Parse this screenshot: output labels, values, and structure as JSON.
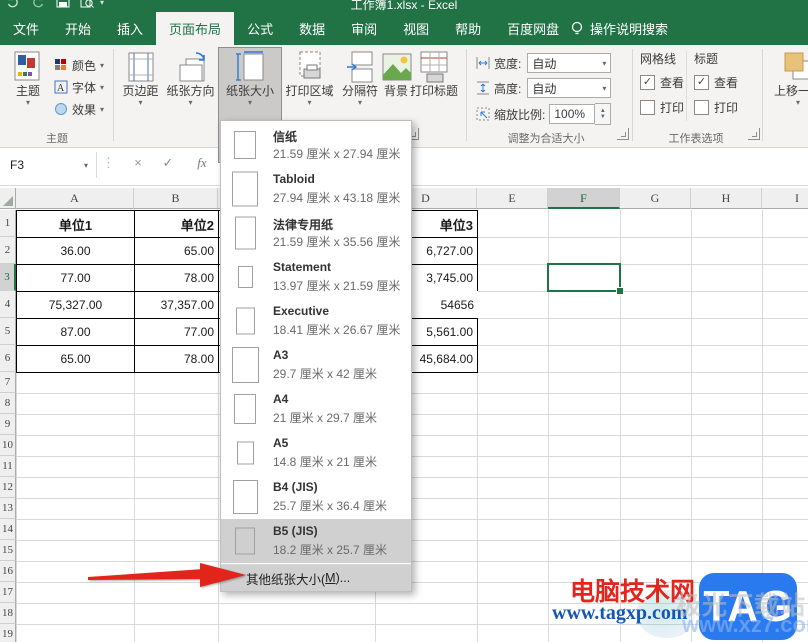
{
  "title_bar": {
    "title": "工作簿1.xlsx - Excel"
  },
  "menu": {
    "tabs": [
      "文件",
      "开始",
      "插入",
      "页面布局",
      "公式",
      "数据",
      "审阅",
      "视图",
      "帮助",
      "百度网盘"
    ],
    "tab_ids": [
      "file",
      "home",
      "insert",
      "page-layout",
      "formulas",
      "data",
      "review",
      "view",
      "help",
      "baidu-netdisk"
    ],
    "active_index": 3,
    "search": "操作说明搜索"
  },
  "ribbon": {
    "themes": {
      "group_label": "主题",
      "theme_button": "主题",
      "colors": "颜色",
      "fonts": "字体",
      "effects": "效果"
    },
    "page_setup": {
      "buttons": [
        "页边距",
        "纸张方向",
        "纸张大小",
        "打印区域",
        "分隔符",
        "背景",
        "打印标题"
      ]
    },
    "scale": {
      "group_label": "调整为合适大小",
      "width_label": "宽度:",
      "width_value": "自动",
      "height_label": "高度:",
      "height_value": "自动",
      "scale_label": "缩放比例:",
      "scale_value": "100%"
    },
    "sheet_options": {
      "group_label": "工作表选项",
      "gridlines_title": "网格线",
      "headings_title": "标题",
      "view_label": "查看",
      "print_label": "打印"
    },
    "arrange": {
      "bring_forward": "上移一层"
    }
  },
  "formula_bar": {
    "name_box": "F3",
    "fx": "fx"
  },
  "paper_size_menu": {
    "items": [
      {
        "name": "信纸",
        "dims": "21.59 厘米 x 27.94 厘米",
        "iw": 20,
        "ih": 26,
        "selected": false
      },
      {
        "name": "Tabloid",
        "dims": "27.94 厘米 x 43.18 厘米",
        "iw": 24,
        "ih": 33,
        "selected": false
      },
      {
        "name": "法律专用纸",
        "dims": "21.59 厘米 x 35.56 厘米",
        "iw": 19,
        "ih": 31,
        "selected": false
      },
      {
        "name": "Statement",
        "dims": "13.97 厘米 x 21.59 厘米",
        "iw": 13,
        "ih": 20,
        "selected": false
      },
      {
        "name": "Executive",
        "dims": "18.41 厘米 x 26.67 厘米",
        "iw": 17,
        "ih": 25,
        "selected": false
      },
      {
        "name": "A3",
        "dims": "29.7 厘米 x 42 厘米",
        "iw": 25,
        "ih": 34,
        "selected": false
      },
      {
        "name": "A4",
        "dims": "21 厘米 x 29.7 厘米",
        "iw": 20,
        "ih": 28,
        "selected": false
      },
      {
        "name": "A5",
        "dims": "14.8 厘米 x 21 厘米",
        "iw": 15,
        "ih": 21,
        "selected": false
      },
      {
        "name": "B4 (JIS)",
        "dims": "25.7 厘米 x 36.4 厘米",
        "iw": 23,
        "ih": 32,
        "selected": false
      },
      {
        "name": "B5 (JIS)",
        "dims": "18.2 厘米 x 25.7 厘米",
        "iw": 18,
        "ih": 25,
        "selected": true
      }
    ],
    "footer_pre": "其他纸张大小(",
    "footer_key": "M",
    "footer_post": ")..."
  },
  "sheet": {
    "col_headers": [
      "A",
      "B",
      "C",
      "D",
      "E",
      "F",
      "G",
      "H",
      "I"
    ],
    "row_count": 19,
    "selected_col": "F",
    "selected_row": 3,
    "table": {
      "rows": [
        {
          "a": "单位1",
          "b": "单位2",
          "c": "",
          "d": "单位3"
        },
        {
          "a": "36.00",
          "b": "65.00",
          "c": "",
          "d": "6,727.00"
        },
        {
          "a": "77.00",
          "b": "78.00",
          "c": "",
          "d": "3,745.00"
        },
        {
          "a": "75,327.00",
          "b": "37,357.00",
          "c": "",
          "d": "54656"
        },
        {
          "a": "87.00",
          "b": "77.00",
          "c": "",
          "d": "5,561.00"
        },
        {
          "a": "65.00",
          "b": "78.00",
          "c": "",
          "d": "45,684.00"
        }
      ]
    }
  },
  "watermark": {
    "site": "电脑技术网",
    "url": "www.tagxp.com",
    "badge": "TAG",
    "ghost_text1": "极光下载站",
    "ghost_text2": "www.xz7.com"
  }
}
